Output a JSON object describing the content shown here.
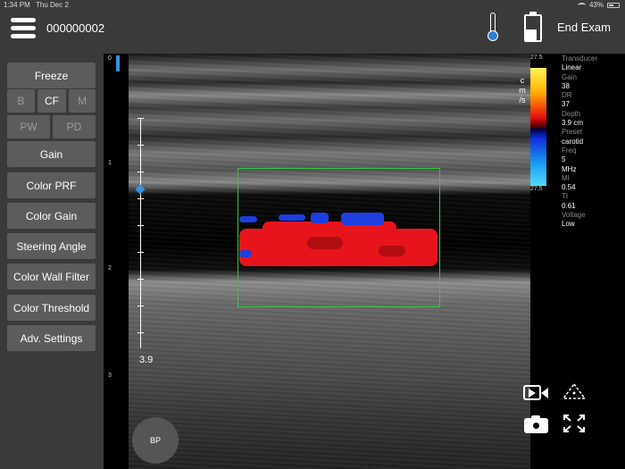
{
  "status_bar": {
    "time": "1:34 PM",
    "date": "Thu Dec 2",
    "battery": "43%"
  },
  "header": {
    "patient_id": "000000002",
    "end_exam_label": "End Exam"
  },
  "left_panel": {
    "freeze_label": "Freeze",
    "modes_row1": [
      "B",
      "CF",
      "M"
    ],
    "modes_row2": [
      "PW",
      "PD"
    ],
    "active_mode": "CF",
    "buttons": [
      "Gain",
      "Color PRF",
      "Color Gain",
      "Steering Angle",
      "Color Wall Filter",
      "Color Threshold",
      "Adv. Settings"
    ],
    "bp_label": "BP"
  },
  "ruler": {
    "labels": [
      "0",
      "1",
      "2",
      "3"
    ]
  },
  "image": {
    "depth_label": "3.9"
  },
  "color_bar": {
    "top": "27.5",
    "bottom": "27.5",
    "unit": [
      "c",
      "m",
      "/s"
    ]
  },
  "params": [
    {
      "key": "Transducer",
      "value": "Linear"
    },
    {
      "key": "Gain",
      "value": "38"
    },
    {
      "key": "DR",
      "value": "37"
    },
    {
      "key": "Depth",
      "value": "3.9 cm"
    },
    {
      "key": "Preset",
      "value": "carotid"
    },
    {
      "key": "Freq",
      "value": "5\nMHz"
    },
    {
      "key": "MI",
      "value": "0.54"
    },
    {
      "key": "TI",
      "value": "0.61"
    },
    {
      "key": "Voltage",
      "value": "Low"
    }
  ],
  "icons": [
    "menu-icon",
    "thermometer-icon",
    "battery-icon",
    "video-record-icon",
    "camera-icon",
    "orientation-icon",
    "fullscreen-icon"
  ]
}
